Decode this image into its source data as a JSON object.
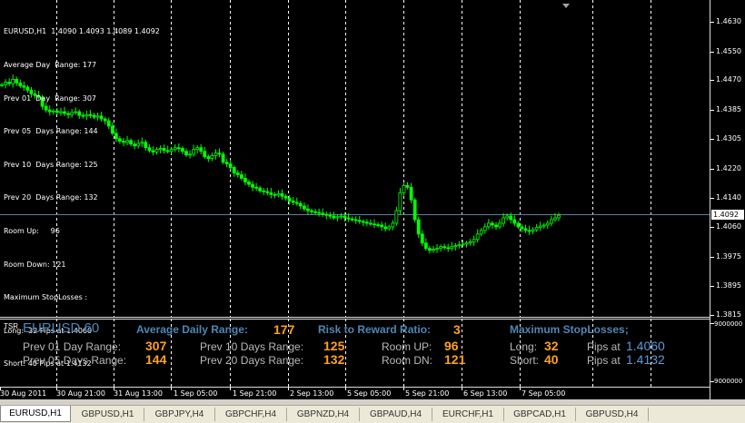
{
  "chart_header": {
    "symbol_line": "EURUSD,H1  1.4090 1.4093 1.4089 1.4092",
    "info_lines": [
      "Average Day  Range: 177",
      "Prev 01  Day  Range: 307",
      "Prev 05  Days Range: 144",
      "Prev 10  Days Range: 125",
      "Prev 20  Days Range: 132",
      "Room Up:     96",
      "Room Down: 121",
      "Maximum StopLosses :",
      "Long:  32 Pips at 1.4060",
      "Short: 40 Pips at 1.4132"
    ]
  },
  "price_axis": {
    "labels": [
      "1.4630",
      "1.4550",
      "1.4470",
      "1.4385",
      "1.4305",
      "1.4220",
      "1.4140",
      "1.4060",
      "1.3975",
      "1.3895",
      "1.3815"
    ],
    "current_price": "1.4092",
    "indicator_labels": [
      "9000000",
      "9000000"
    ]
  },
  "time_axis": {
    "labels": [
      "30 Aug 2011",
      "30 Aug 21:00",
      "31 Aug 13:00",
      "1 Sep 05:00",
      "1 Sep 21:00",
      "2 Sep 13:00",
      "5 Sep 05:00",
      "5 Sep 21:00",
      "6 Sep 13:00",
      "7 Sep 05:00"
    ]
  },
  "indicator": {
    "tsr_tag": "TSR",
    "symbol_title": "EURUSD 60",
    "avg_daily_range_label": "Average Daily Range:",
    "avg_daily_range_value": "177",
    "risk_reward_label": "Risk to Reward Ratio:",
    "risk_reward_value": "3",
    "max_stop_label": "Maximum StopLosses;",
    "prev01_label": "Prev 01 Day Range:",
    "prev01_value": "307",
    "prev05_label": "Prev 05 Days Range:",
    "prev05_value": "144",
    "prev10_label": "Prev 10 Days Range:",
    "prev10_value": "125",
    "prev20_label": "Prev 20 Days Range:",
    "prev20_value": "132",
    "room_up_label": "Room UP:",
    "room_up_value": "96",
    "room_dn_label": "Room DN:",
    "room_dn_value": "121",
    "long_label": "Long:",
    "long_value": "32",
    "long_pips_label": "Pips at",
    "long_price": "1.4060",
    "short_label": "Short:",
    "short_value": "40",
    "short_pips_label": "Pips at",
    "short_price": "1.4132"
  },
  "tabs": [
    "EURUSD,H1",
    "GBPUSD,H1",
    "GBPJPY,H4",
    "GBPCHF,H4",
    "GBPNZD,H4",
    "GBPAUD,H4",
    "EURCHF,H1",
    "GBPCAD,H1",
    "GBPUSD,H4"
  ],
  "colors": {
    "candles": "#00ff00",
    "background": "#000000",
    "grid": "#ffffff",
    "bid_line": "#5f7f9f",
    "accent_value": "#ffa21d",
    "accent_label": "#4f86b4"
  },
  "chart_data": {
    "type": "candlestick",
    "symbol": "EURUSD",
    "timeframe": "H1",
    "ylim": [
      1.3815,
      1.463
    ],
    "close_series": [
      1.4455,
      1.4462,
      1.4458,
      1.447,
      1.446,
      1.4452,
      1.4448,
      1.444,
      1.443,
      1.4425,
      1.442,
      1.4395,
      1.4385,
      1.438,
      1.4382,
      1.4378,
      1.438,
      1.4375,
      1.4372,
      1.4378,
      1.438,
      1.437,
      1.4368,
      1.4372,
      1.437,
      1.4365,
      1.4368,
      1.436,
      1.4355,
      1.434,
      1.432,
      1.4305,
      1.4298,
      1.4295,
      1.43,
      1.429,
      1.4285,
      1.4292,
      1.4295,
      1.428,
      1.4272,
      1.4268,
      1.4275,
      1.4278,
      1.4272,
      1.427,
      1.4275,
      1.428,
      1.4278,
      1.427,
      1.426,
      1.4262,
      1.4275,
      1.428,
      1.427,
      1.4255,
      1.425,
      1.4258,
      1.4265,
      1.4262,
      1.424,
      1.4235,
      1.4225,
      1.421,
      1.4205,
      1.4195,
      1.4185,
      1.4178,
      1.417,
      1.4168,
      1.416,
      1.4158,
      1.4155,
      1.415,
      1.4148,
      1.4152,
      1.4145,
      1.414,
      1.4132,
      1.4128,
      1.4125,
      1.4118,
      1.411,
      1.4105,
      1.4102,
      1.41,
      1.4098,
      1.4095,
      1.4092,
      1.409,
      1.4085,
      1.4088,
      1.409,
      1.4085,
      1.4082,
      1.408,
      1.4078,
      1.4075,
      1.4073,
      1.407,
      1.4068,
      1.4066,
      1.4065,
      1.406,
      1.4055,
      1.406,
      1.407,
      1.4105,
      1.4155,
      1.4175,
      1.417,
      1.4135,
      1.408,
      1.404,
      1.4015,
      1.4,
      1.3995,
      1.3998,
      1.4,
      1.4005,
      1.4002,
      1.4,
      1.4005,
      1.4008,
      1.401,
      1.4012,
      1.4015,
      1.4018,
      1.4025,
      1.404,
      1.405,
      1.406,
      1.407,
      1.4065,
      1.406,
      1.407,
      1.4085,
      1.409,
      1.408,
      1.407,
      1.406,
      1.4055,
      1.405,
      1.4048,
      1.4052,
      1.4058,
      1.4062,
      1.4065,
      1.407,
      1.408,
      1.4085,
      1.4092
    ]
  }
}
